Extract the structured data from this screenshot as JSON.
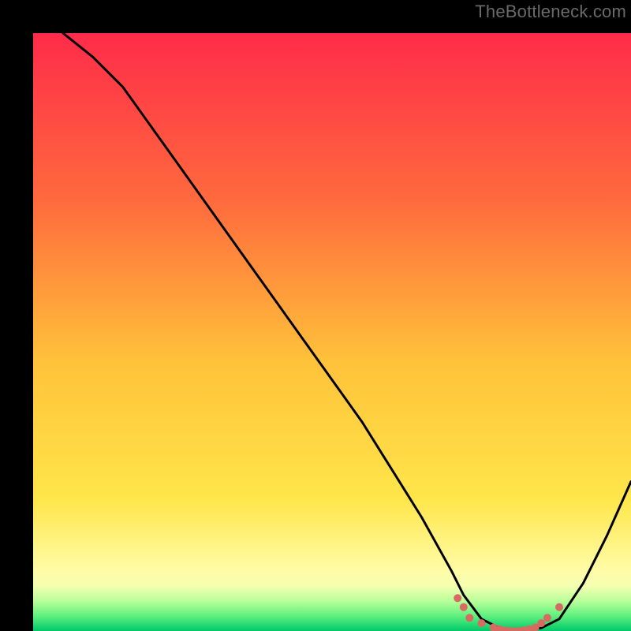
{
  "watermark": {
    "text": "TheBottleneck.com"
  },
  "colors": {
    "gradient_top": "#ff2b4a",
    "gradient_mid1": "#ff8a3a",
    "gradient_mid2": "#ffe13a",
    "gradient_mid3": "#fff9a0",
    "gradient_bottom_band_top": "#eaffc0",
    "gradient_bottom_band_mid": "#7cf58a",
    "gradient_bottom": "#00c96a",
    "curve": "#000000",
    "markers": "#d96a62"
  },
  "chart_data": {
    "type": "line",
    "title": "",
    "xlabel": "",
    "ylabel": "",
    "xlim": [
      0,
      100
    ],
    "ylim": [
      0,
      100
    ],
    "grid": false,
    "series": [
      {
        "name": "bottleneck-curve",
        "x": [
          5,
          10,
          15,
          20,
          25,
          30,
          35,
          40,
          45,
          50,
          55,
          60,
          65,
          70,
          72,
          75,
          78,
          80,
          82,
          85,
          88,
          92,
          96,
          100
        ],
        "y": [
          100,
          96,
          91,
          84,
          77,
          70,
          63,
          56,
          49,
          42,
          35,
          27,
          19,
          10,
          6,
          2,
          0.5,
          0,
          0,
          0.5,
          2,
          8,
          16,
          25
        ]
      }
    ],
    "markers": {
      "name": "flat-minimum-dots",
      "x": [
        71,
        72,
        73,
        75,
        77,
        78,
        79,
        80,
        81,
        82,
        83,
        84,
        85,
        86,
        88
      ],
      "y": [
        5.5,
        4,
        2.2,
        1.3,
        0.6,
        0.3,
        0.1,
        0,
        0,
        0.1,
        0.3,
        0.6,
        1.3,
        2.2,
        4
      ]
    }
  }
}
